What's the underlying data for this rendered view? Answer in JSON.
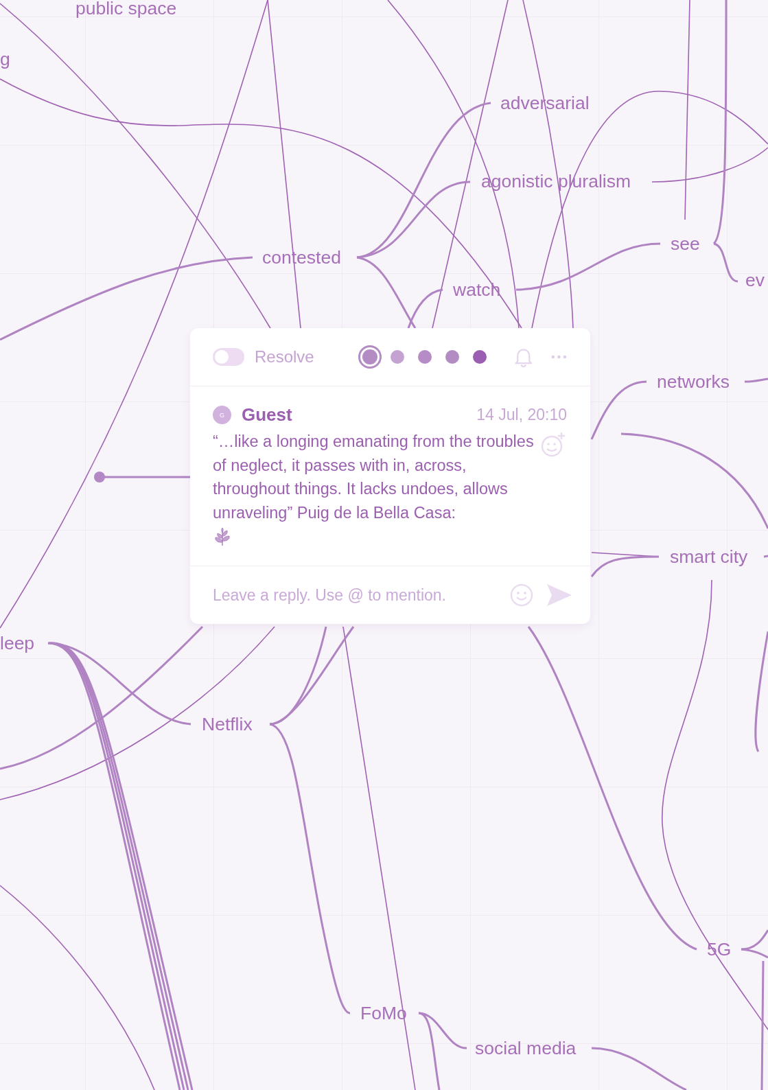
{
  "canvas": {
    "nodes": [
      {
        "label": "public space"
      },
      {
        "label": "g"
      },
      {
        "label": "adversarial"
      },
      {
        "label": "agonistic pluralism"
      },
      {
        "label": "contested"
      },
      {
        "label": "see"
      },
      {
        "label": "watch"
      },
      {
        "label": "ev"
      },
      {
        "label": "networks"
      },
      {
        "label": "smart city"
      },
      {
        "label": "leep"
      },
      {
        "label": "Netflix"
      },
      {
        "label": "5G"
      },
      {
        "label": "FoMo"
      },
      {
        "label": "social media"
      }
    ]
  },
  "comment": {
    "resolve": {
      "label": "Resolve",
      "on": false
    },
    "colors": [
      {
        "color": "#b48cc4",
        "selected": true
      },
      {
        "color": "#c4a3d3",
        "selected": false
      },
      {
        "color": "#b58cc6",
        "selected": false
      },
      {
        "color": "#b48cc4",
        "selected": false
      },
      {
        "color": "#9a5fb0",
        "selected": false
      }
    ],
    "author": {
      "initial": "G",
      "name": "Guest"
    },
    "time": "14 Jul, 20:10",
    "text": "“…like a longing emanating from the troubles of neglect, it passes with in, across, throughout things. It lacks undoes, allows unraveling” Puig de la Bella Casa:",
    "reply": {
      "placeholder": "Leave a reply. Use @ to mention."
    }
  }
}
